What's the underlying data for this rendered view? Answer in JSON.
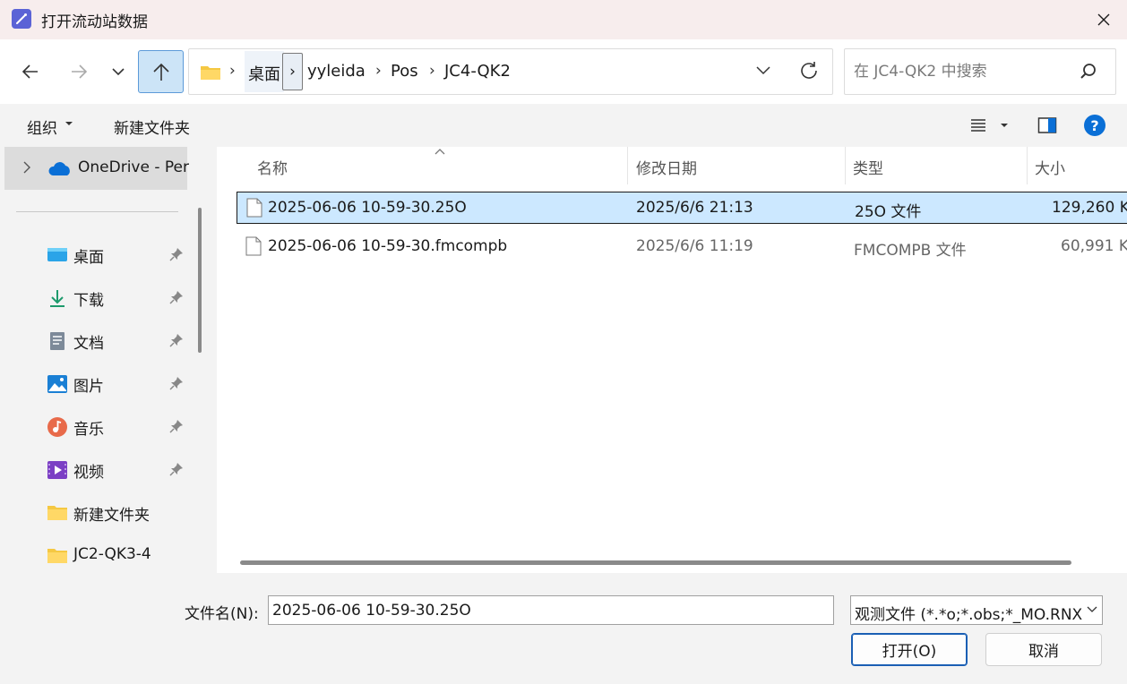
{
  "window": {
    "title": "打开流动站数据"
  },
  "address": {
    "crumbs": [
      "桌面",
      "yyleida",
      "Pos",
      "JC4-QK2"
    ]
  },
  "search": {
    "placeholder": "在 JC4-QK2 中搜索"
  },
  "toolbar": {
    "organize": "组织",
    "new_folder": "新建文件夹"
  },
  "sidebar": {
    "onedrive": "OneDrive - Per",
    "items": [
      {
        "label": "桌面",
        "icon": "desktop-icon",
        "pinned": true
      },
      {
        "label": "下载",
        "icon": "download-icon",
        "pinned": true
      },
      {
        "label": "文档",
        "icon": "document-icon",
        "pinned": true
      },
      {
        "label": "图片",
        "icon": "pictures-icon",
        "pinned": true
      },
      {
        "label": "音乐",
        "icon": "music-icon",
        "pinned": true
      },
      {
        "label": "视频",
        "icon": "video-icon",
        "pinned": true
      },
      {
        "label": "新建文件夹",
        "icon": "folder-icon",
        "pinned": false
      },
      {
        "label": "JC2-QK3-4",
        "icon": "folder-icon",
        "pinned": false
      }
    ]
  },
  "columns": {
    "name": "名称",
    "modified": "修改日期",
    "type": "类型",
    "size": "大小"
  },
  "files": [
    {
      "name": "2025-06-06 10-59-30.25O",
      "modified": "2025/6/6 21:13",
      "type": "25O 文件",
      "size": "129,260 K",
      "selected": true
    },
    {
      "name": "2025-06-06 10-59-30.fmcompb",
      "modified": "2025/6/6 11:19",
      "type": "FMCOMPB 文件",
      "size": "60,991 K",
      "selected": false
    }
  ],
  "bottom": {
    "filename_label": "文件名(N):",
    "filename_value": "2025-06-06 10-59-30.25O",
    "filter": "观测文件 (*.*o;*.obs;*_MO.RNX)",
    "open": "打开(O)",
    "cancel": "取消"
  },
  "colors": {
    "accent": "#0a6fd6",
    "selection": "#cce8ff",
    "up_button": "#cce4f7"
  }
}
